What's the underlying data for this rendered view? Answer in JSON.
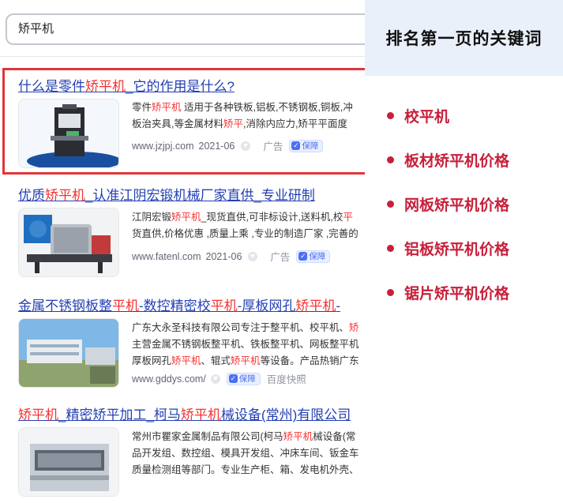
{
  "search": {
    "query": "矫平机"
  },
  "results": [
    {
      "title": [
        "什么是零件",
        "矫平机",
        "_它的作用是什么?"
      ],
      "snippet_lines": [
        [
          "零件",
          "矫平机",
          " 适用于各种铁板,铝板,不锈钢板,铜板,冲"
        ],
        [
          "板治夹具,等金属材料",
          "矫平",
          ",消除内应力,矫平平面度"
        ]
      ],
      "url": "www.jzjpj.com",
      "date": "2021-06",
      "ad_label": "广告",
      "badge": "保障"
    },
    {
      "title": [
        "优质",
        "矫平机",
        "_认准江阴宏锻机械厂家直供_专业研制"
      ],
      "snippet_lines": [
        [
          "江阴宏锻",
          "矫平机",
          "_现货直供,可非标设计,送料机,校",
          "平"
        ],
        [
          "货直供,价格优惠 ,质量上乘 ,专业的制造厂家 ,完善的"
        ]
      ],
      "url": "www.fatenl.com",
      "date": "2021-06",
      "ad_label": "广告",
      "badge": "保障"
    },
    {
      "title": [
        "金属不锈钢板整",
        "平机",
        "-数控精密校",
        "平机",
        "-厚板网孔",
        "矫平机",
        "-"
      ],
      "snippet_lines": [
        [
          "广东大永圣科技有限公司专注于整平机、校平机、",
          "矫"
        ],
        [
          "主营金属不锈钢板整平机、铁板整平机、网板整平机"
        ],
        [
          "厚板网孔",
          "矫平机",
          "、辊式",
          "矫平机",
          "等设备。产品热销广东"
        ]
      ],
      "url": "www.gddys.com/",
      "badge": "保障",
      "kuaizhao": "百度快照"
    },
    {
      "title": [
        "矫平机",
        "_精密矫平加工_柯马",
        "矫平机",
        "械设备(常州)有限公司"
      ],
      "snippet_lines": [
        [
          "常州市瞿家金属制品有限公司(柯马",
          "矫平机",
          "械设备(常"
        ],
        [
          "品开发组、数控组、模具开发组、冲床车间、钣金车"
        ],
        [
          "质量检测组等部门。专业生产柜、箱、发电机外壳、"
        ]
      ]
    }
  ],
  "panel": {
    "title": "排名第一页的关键词",
    "keywords": [
      "校平机",
      "板材矫平机价格",
      "网板矫平机价格",
      "铝板矫平机价格",
      "锯片矫平机价格"
    ]
  },
  "colors": {
    "accent_red": "#c7203a",
    "link_blue": "#2440b3",
    "highlight_red": "#f73131",
    "panel_bg": "#e9f0fa"
  }
}
